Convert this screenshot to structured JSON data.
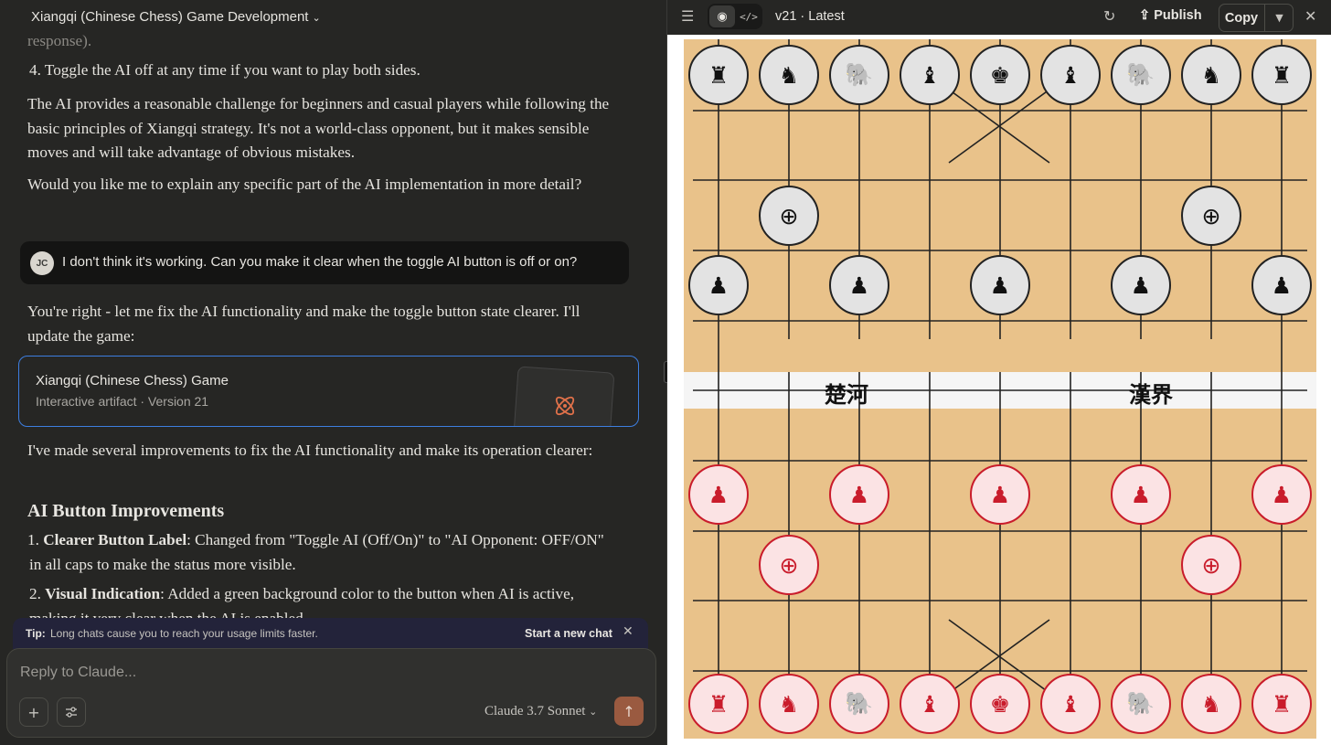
{
  "chat": {
    "title": "Xiangqi (Chinese Chess) Game Development",
    "prev_fragment": "response).",
    "list_item_4_num": "4.",
    "list_item_4": "Toggle the AI off at any time if you want to play both sides.",
    "para1": "The AI provides a reasonable challenge for beginners and casual players while following the basic principles of Xiangqi strategy. It's not a world-class opponent, but it makes sensible moves and will take advantage of obvious mistakes.",
    "para2": "Would you like me to explain any specific part of the AI implementation in more detail?",
    "user_initials": "JC",
    "user_message": "I don't think it's working. Can you make it clear when the toggle AI button is off or on?",
    "reply1": "You're right - let me fix the AI functionality and make the toggle button state clearer. I'll update the game:",
    "artifact": {
      "title": "Xiangqi (Chinese Chess) Game",
      "subtitle": "Interactive artifact · Version 21",
      "icon": "atom-icon"
    },
    "reply2": "I've made several improvements to fix the AI functionality and make its operation clearer:",
    "heading": "AI Button Improvements",
    "item1_num": "1.",
    "item1_bold": "Clearer Button Label",
    "item1_text": ": Changed from \"Toggle AI (Off/On)\" to \"AI Opponent: OFF/ON\" in all caps to make the status more visible.",
    "item2_num": "2.",
    "item2_bold": "Visual Indication",
    "item2_text": ": Added a green background color to the button when AI is active, making it very clear when the AI is enabled."
  },
  "tip": {
    "label": "Tip:",
    "text": "Long chats cause you to reach your usage limits faster.",
    "action": "Start a new chat"
  },
  "composer": {
    "placeholder": "Reply to Claude...",
    "model": "Claude 3.7 Sonnet"
  },
  "artifact_panel": {
    "version": "v21 · Latest",
    "publish": "Publish",
    "copy": "Copy"
  },
  "board": {
    "river_left": "楚河",
    "river_right": "漢界",
    "colors": {
      "board": "#e9c28a",
      "black_piece": "#e3e3e3",
      "red_piece": "#fbe3e4",
      "red_accent": "#c91c2b"
    },
    "black_back_rank": [
      "♜",
      "♞",
      "🐘",
      "♝",
      "♚",
      "♝",
      "🐘",
      "♞",
      "♜"
    ],
    "black_cannon": "⊕",
    "black_pawn": "♟",
    "red_back_rank": [
      "♜",
      "♞",
      "🐘",
      "♝",
      "♚",
      "♝",
      "🐘",
      "♞",
      "♜"
    ],
    "red_cannon": "⊕",
    "red_pawn": "♟"
  }
}
